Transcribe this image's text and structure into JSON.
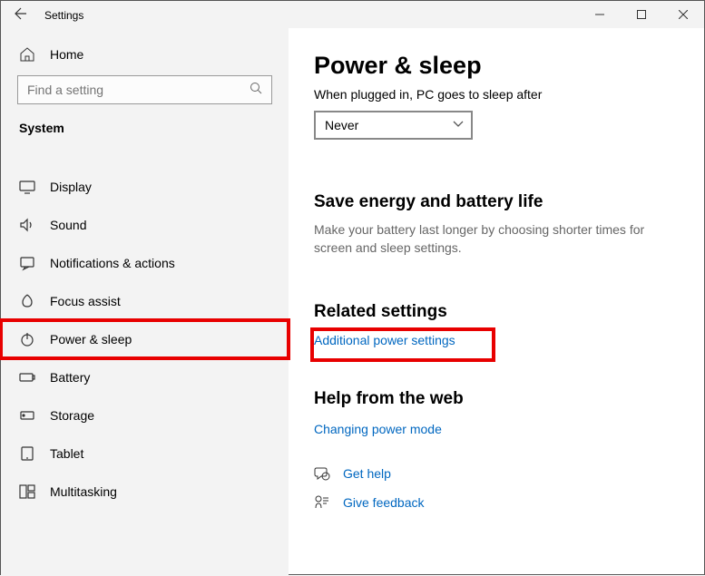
{
  "titlebar": {
    "title": "Settings"
  },
  "sidebar": {
    "home_label": "Home",
    "search_placeholder": "Find a setting",
    "section_label": "System",
    "items": [
      {
        "label": "Display"
      },
      {
        "label": "Sound"
      },
      {
        "label": "Notifications & actions"
      },
      {
        "label": "Focus assist"
      },
      {
        "label": "Power & sleep"
      },
      {
        "label": "Battery"
      },
      {
        "label": "Storage"
      },
      {
        "label": "Tablet"
      },
      {
        "label": "Multitasking"
      }
    ]
  },
  "content": {
    "title": "Power & sleep",
    "plugged_label": "When plugged in, PC goes to sleep after",
    "plugged_value": "Never",
    "energy_heading": "Save energy and battery life",
    "energy_text": "Make your battery last longer by choosing shorter times for screen and sleep settings.",
    "related_heading": "Related settings",
    "additional_link": "Additional power settings",
    "help_heading": "Help from the web",
    "help_link": "Changing power mode",
    "get_help": "Get help",
    "give_feedback": "Give feedback"
  }
}
